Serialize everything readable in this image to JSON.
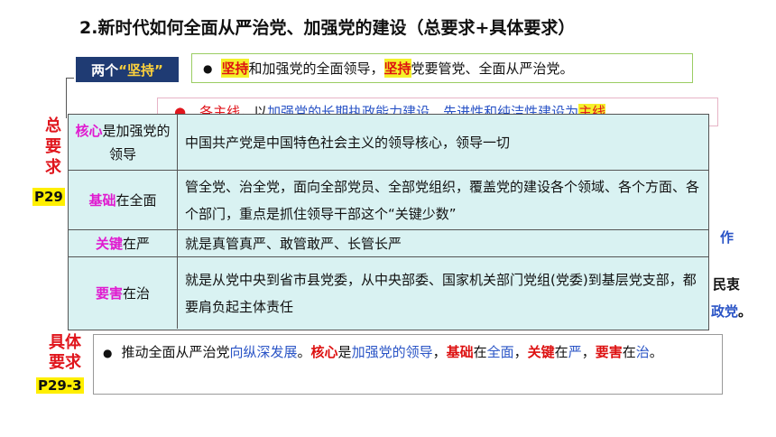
{
  "title": "2.新时代如何全面从严治党、加强党的建设（总要求+具体要求）",
  "persist": {
    "label_prefix": "两个",
    "label_quote": "“坚持”",
    "bullet": "●",
    "seg1": "坚持",
    "seg2": "和加强党的全面领导，",
    "seg3": "坚持",
    "seg4": "党要管党、全面从严治党。"
  },
  "general_requirement": {
    "label": [
      "总",
      "要",
      "求"
    ],
    "page": "P29"
  },
  "hidden_line": {
    "seg1": "●　各主线，",
    "seg2": "以",
    "seg3": "加强党的长期执政能力建设、先进性和纯洁性建设为",
    "seg4": "主线"
  },
  "peek": {
    "p1": "作",
    "p2": "民衷",
    "p3_blue": "政党",
    "p3_black": "。"
  },
  "table": {
    "rows": [
      {
        "key_mg": "核心",
        "key_rest": "是加强党的领导",
        "value": "中国共产党是中国特色社会主义的领导核心，领导一切"
      },
      {
        "key_mg": "基础",
        "key_rest": "在全面",
        "value": "管全党、治全党，面向全部党员、全部党组织，覆盖党的建设各个领域、各个方面、各个部门，重点是抓住领导干部这个“关键少数”"
      },
      {
        "key_mg": "关键",
        "key_rest": "在严",
        "value": "就是真管真严、敢管敢严、长管长严"
      },
      {
        "key_mg": "要害",
        "key_rest": "在治",
        "value": "就是从党中央到省市县党委，从中央部委、国家机关部门党组(党委)到基层党支部，都要肩负起主体责任"
      }
    ]
  },
  "specific_requirement": {
    "label": [
      "具体",
      "要求"
    ],
    "page": "P29-3",
    "bullet": "●",
    "s1": "推动全面从严治党",
    "s2": "向纵深发展",
    "s3": "。",
    "s4": "核心",
    "s5": "是",
    "s6": "加强党的领导",
    "s7": "，",
    "s8": "基础",
    "s9": "在",
    "s10": "全面",
    "s11": "，",
    "s12": "关键",
    "s13": "在",
    "s14": "严",
    "s15": "，",
    "s16": "要害",
    "s17": "在",
    "s18": "治",
    "s19": "。"
  },
  "colors": {
    "red": "#e0161d",
    "blue": "#2a54c6",
    "magenta": "#e01ad0",
    "navy": "#1f3b73",
    "table_bg": "#d9f2f2",
    "highlight": "#f4f12a"
  }
}
